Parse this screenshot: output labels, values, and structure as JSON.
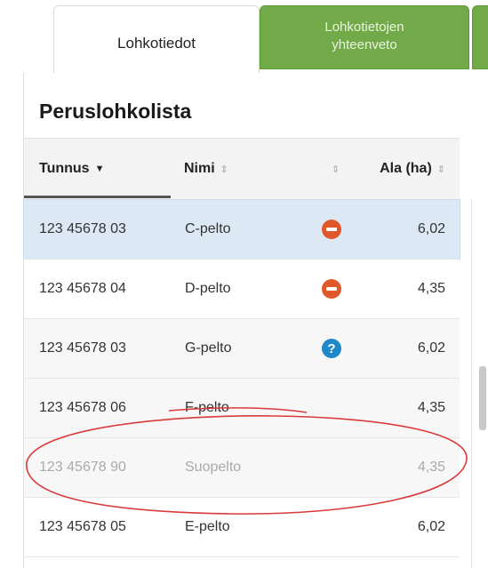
{
  "tabs": [
    {
      "label": "Lohkotiedot",
      "active": true
    },
    {
      "label_line1": "Lohkotietojen",
      "label_line2": "yhteenveto",
      "active": false
    }
  ],
  "colors": {
    "tab_green": "#72aa4a",
    "selected_row": "#dce9f5",
    "minus_icon": "#e0572a",
    "question_icon": "#1e88c8",
    "annotation": "#d93a3a"
  },
  "section_title": "Peruslohkolista",
  "table": {
    "columns": [
      {
        "label": "Tunnus",
        "sort": "desc-active"
      },
      {
        "label": "Nimi",
        "sort": "sortable"
      },
      {
        "label": "",
        "sort": "sortable"
      },
      {
        "label": "Ala (ha)",
        "sort": "sortable"
      }
    ],
    "rows": [
      {
        "tunnus": "123 45678 03",
        "nimi": "C-pelto",
        "icon": "minus-circle-icon",
        "ala": "6,02",
        "state": "selected"
      },
      {
        "tunnus": "123 45678 04",
        "nimi": "D-pelto",
        "icon": "minus-circle-icon",
        "ala": "4,35",
        "state": "normal"
      },
      {
        "tunnus": "123 45678 03",
        "nimi": "G-pelto",
        "icon": "question-circle-icon",
        "ala": "6,02",
        "state": "normal"
      },
      {
        "tunnus": "123 45678 06",
        "nimi": "F-pelto",
        "icon": "",
        "ala": "4,35",
        "state": "strikethrough"
      },
      {
        "tunnus": "123 45678 90",
        "nimi": "Suopelto",
        "icon": "",
        "ala": "4,35",
        "state": "dimmed"
      },
      {
        "tunnus": "123 45678 05",
        "nimi": "E-pelto",
        "icon": "",
        "ala": "6,02",
        "state": "normal"
      }
    ]
  }
}
